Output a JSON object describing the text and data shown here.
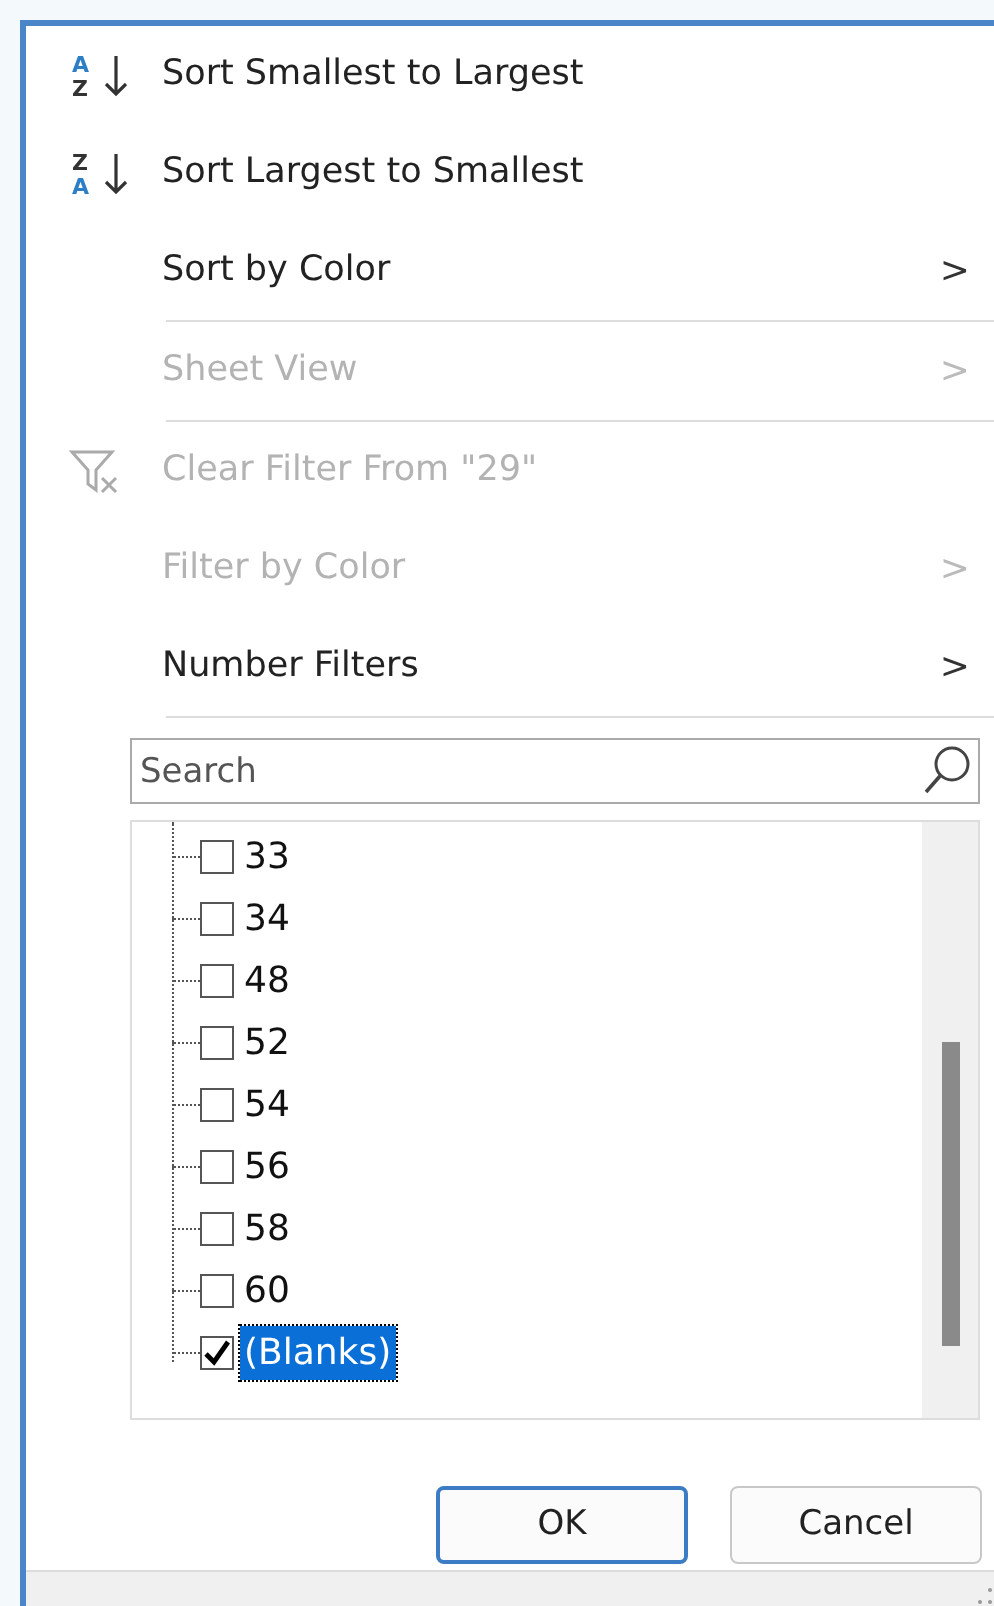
{
  "menu_items": [
    {
      "kind": "sort",
      "letters": [
        {
          "text": "A",
          "color": "#2d7fc5"
        },
        {
          "text": "Z",
          "color": "#333333"
        }
      ],
      "label": "Sort Smallest to Largest",
      "disabled": false
    },
    {
      "kind": "sort",
      "letters": [
        {
          "text": "Z",
          "color": "#333333"
        },
        {
          "text": "A",
          "color": "#2d7fc5"
        }
      ],
      "label": "Sort Largest to Smallest",
      "disabled": false
    },
    {
      "kind": "submenu",
      "label": "Sort by Color",
      "chevron": ">",
      "disabled": false,
      "separator_after": true
    },
    {
      "kind": "submenu",
      "label": "Sheet View",
      "chevron": ">",
      "disabled": true,
      "separator_after": true
    },
    {
      "kind": "clear",
      "label": "Clear Filter From \"29\"",
      "disabled": true
    },
    {
      "kind": "submenu",
      "label": "Filter by Color",
      "chevron": ">",
      "disabled": true
    },
    {
      "kind": "submenu",
      "label": "Number Filters",
      "chevron": ">",
      "disabled": false,
      "separator_after": true
    }
  ],
  "search": {
    "placeholder": "Search"
  },
  "values": [
    {
      "label": "33",
      "checked": false,
      "selected": false
    },
    {
      "label": "34",
      "checked": false,
      "selected": false
    },
    {
      "label": "48",
      "checked": false,
      "selected": false
    },
    {
      "label": "52",
      "checked": false,
      "selected": false
    },
    {
      "label": "54",
      "checked": false,
      "selected": false
    },
    {
      "label": "56",
      "checked": false,
      "selected": false
    },
    {
      "label": "58",
      "checked": false,
      "selected": false
    },
    {
      "label": "60",
      "checked": false,
      "selected": false
    },
    {
      "label": "(Blanks)",
      "checked": true,
      "selected": true
    }
  ],
  "buttons": [
    {
      "label": "OK",
      "default": true
    },
    {
      "label": "Cancel",
      "default": false
    }
  ]
}
